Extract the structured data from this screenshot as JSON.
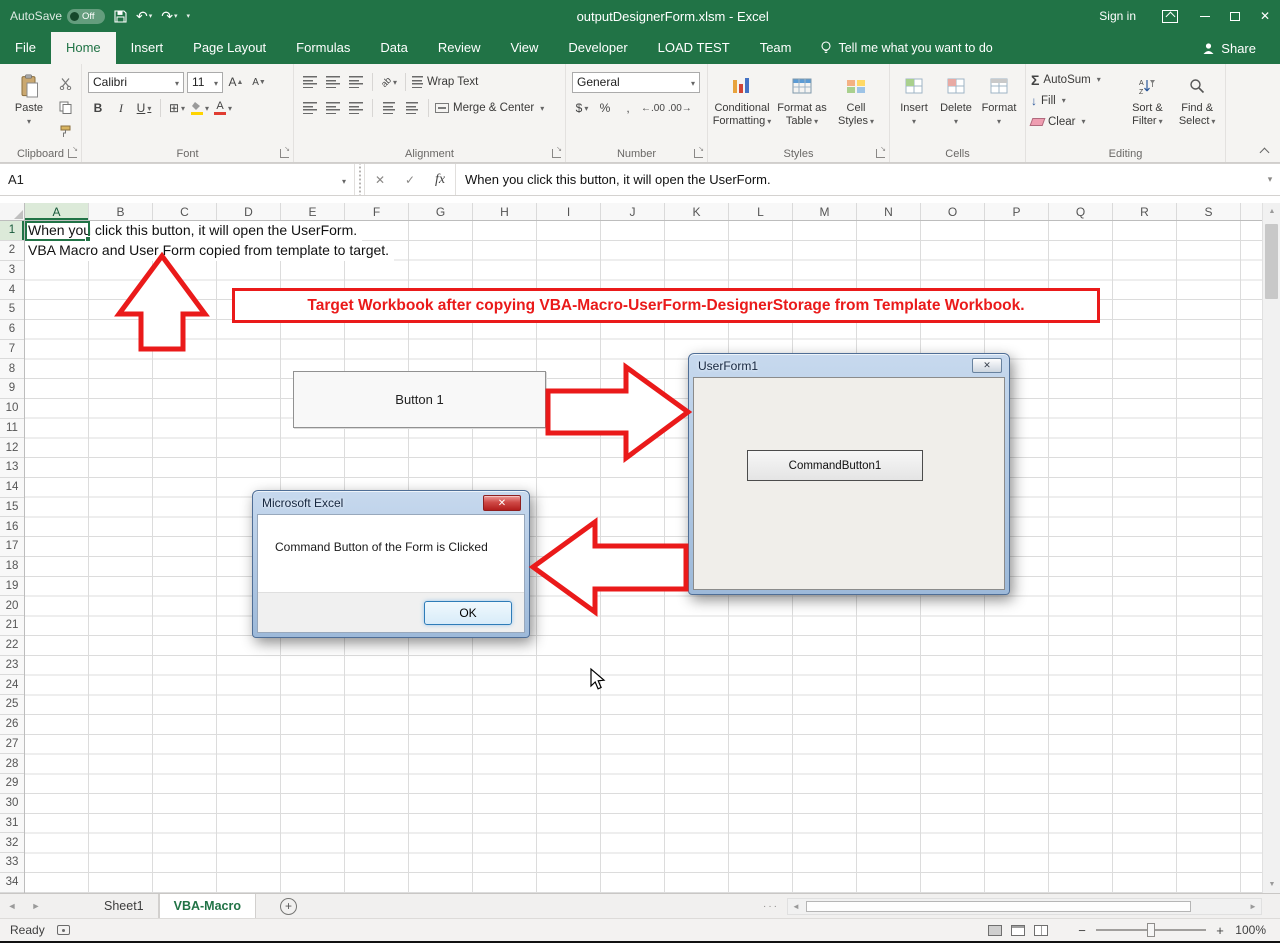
{
  "title_bar": {
    "autosave_label": "AutoSave",
    "autosave_state": "Off",
    "title": "outputDesignerForm.xlsm - Excel",
    "sign_in": "Sign in"
  },
  "icons": {
    "undo": "↶",
    "redo": "↷",
    "dropdown": "▾",
    "cancel": "✕",
    "enter": "✓",
    "fx": "fx",
    "close": "✕",
    "border_grid": "⊞",
    "sigma": "Σ",
    "nav_left": "◄",
    "nav_right": "►",
    "new_sheet": "+",
    "zoom_out": "−",
    "zoom_in": "+",
    "up_triangle": "▲",
    "down_triangle": "▼"
  },
  "ribbon_tabs": {
    "items": [
      "File",
      "Home",
      "Insert",
      "Page Layout",
      "Formulas",
      "Data",
      "Review",
      "View",
      "Developer",
      "LOAD TEST",
      "Team"
    ],
    "active": "Home",
    "tell_me": "Tell me what you want to do",
    "share": "Share"
  },
  "ribbon": {
    "clipboard": {
      "label": "Clipboard",
      "paste": "Paste"
    },
    "font": {
      "label": "Font",
      "name": "Calibri",
      "size": "11",
      "bold": "B",
      "italic": "I",
      "underline": "U",
      "grow": "A",
      "shrink": "A"
    },
    "alignment": {
      "label": "Alignment",
      "wrap_text": "Wrap Text",
      "merge_center": "Merge & Center"
    },
    "number": {
      "label": "Number",
      "format": "General",
      "currency": "$",
      "percent": "%",
      "comma": ",",
      "increase_decimal": "←.00",
      "decrease_decimal": ".00→"
    },
    "styles": {
      "label": "Styles",
      "conditional_line1": "Conditional",
      "conditional_line2": "Formatting",
      "table_line1": "Format as",
      "table_line2": "Table",
      "cellstyles_line1": "Cell",
      "cellstyles_line2": "Styles"
    },
    "cells": {
      "label": "Cells",
      "insert": "Insert",
      "delete": "Delete",
      "format": "Format"
    },
    "editing": {
      "label": "Editing",
      "autosum": "AutoSum",
      "fill": "Fill",
      "clear": "Clear",
      "sort_line1": "Sort &",
      "sort_line2": "Filter",
      "find_line1": "Find &",
      "find_line2": "Select"
    }
  },
  "formula_bar": {
    "name_box": "A1",
    "content": "When you click this button, it will open the UserForm."
  },
  "grid": {
    "columns": [
      "A",
      "B",
      "C",
      "D",
      "E",
      "F",
      "G",
      "H",
      "I",
      "J",
      "K",
      "L",
      "M",
      "N",
      "O",
      "P",
      "Q",
      "R",
      "S"
    ],
    "row_count": 34,
    "selected_cell": "A1",
    "cells": [
      {
        "ref": "A1",
        "text": "When you click this button, it will open the UserForm."
      },
      {
        "ref": "A2",
        "text": "VBA Macro and User Form copied from template to target."
      }
    ]
  },
  "overlays": {
    "banner": {
      "text": "Target Workbook after copying VBA-Macro-UserForm-DesignerStorage from Template Workbook.",
      "color": "#ea1a1a"
    },
    "sheet_button": {
      "label": "Button 1"
    },
    "userform": {
      "title": "UserForm1",
      "command_button": "CommandButton1"
    },
    "msgbox": {
      "title": "Microsoft Excel",
      "message": "Command Button of the Form is Clicked",
      "ok": "OK"
    }
  },
  "sheet_bar": {
    "tabs": [
      "Sheet1",
      "VBA-Macro"
    ],
    "active": "VBA-Macro"
  },
  "status_bar": {
    "status": "Ready",
    "zoom": "100%"
  },
  "colors": {
    "excel_green": "#217346",
    "annotation_red": "#ea1a1a"
  }
}
